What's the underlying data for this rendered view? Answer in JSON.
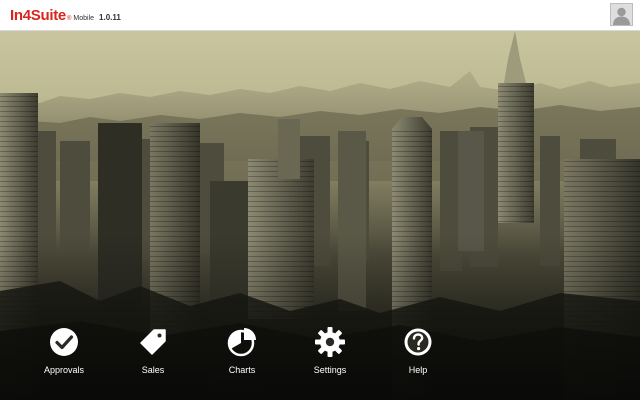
{
  "header": {
    "brand_in4": "In4",
    "brand_suite": "Suite",
    "brand_registered": "®",
    "brand_mobile": "Mobile",
    "version": "1.0.11",
    "avatar_icon": "user-avatar-icon"
  },
  "background": {
    "icon": "city-skyline-photo",
    "tint": "#b7b38a"
  },
  "nav": {
    "items": [
      {
        "label": "Approvals",
        "icon": "check-circle-icon"
      },
      {
        "label": "Sales",
        "icon": "tag-icon"
      },
      {
        "label": "Charts",
        "icon": "pie-chart-icon"
      },
      {
        "label": "Settings",
        "icon": "gear-icon"
      },
      {
        "label": "Help",
        "icon": "question-circle-icon"
      }
    ]
  },
  "colors": {
    "brand": "#d9251c",
    "nav_text": "#ffffff"
  }
}
